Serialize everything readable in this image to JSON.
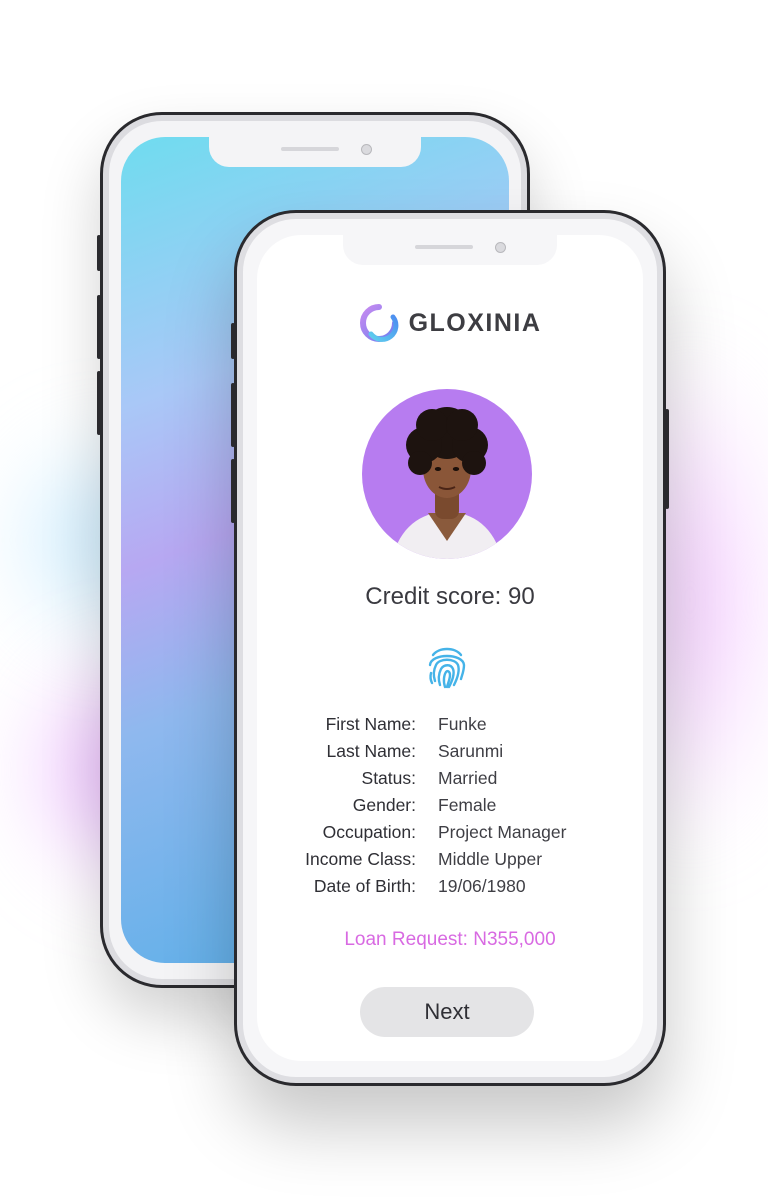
{
  "app": {
    "brand_name": "GLOXINIA",
    "logo_icon": "gloxinia-swirl-icon",
    "accent_color": "#b77cf0",
    "loan_color": "#d86ae2"
  },
  "profile": {
    "avatar_alt": "profile-photo",
    "credit_score_text": "Credit score: 90",
    "fingerprint_icon": "fingerprint-icon"
  },
  "details": [
    {
      "label": "First Name:",
      "value": "Funke"
    },
    {
      "label": "Last Name:",
      "value": "Sarunmi"
    },
    {
      "label": "Status:",
      "value": "Married"
    },
    {
      "label": "Gender:",
      "value": "Female"
    },
    {
      "label": "Occupation:",
      "value": "Project Manager"
    },
    {
      "label": "Income Class:",
      "value": "Middle Upper"
    },
    {
      "label": "Date of Birth:",
      "value": "19/06/1980"
    }
  ],
  "loan": {
    "text": "Loan Request: N355,000"
  },
  "actions": {
    "next_label": "Next"
  }
}
